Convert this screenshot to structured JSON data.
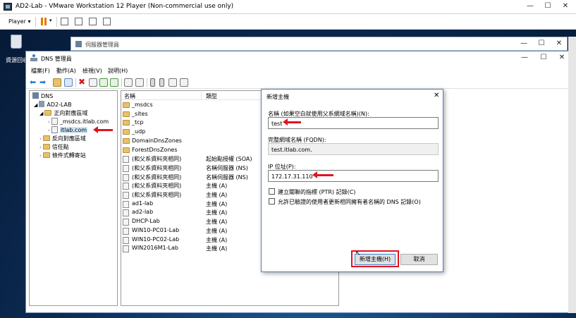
{
  "vmware": {
    "title": "AD2-Lab - VMware Workstation 12 Player (Non-commercial use only)",
    "player_menu": "Player ▾"
  },
  "desktop": {
    "recycle_bin_label": "資源回收"
  },
  "server_manager": {
    "title": "伺服器管理員"
  },
  "dns_manager": {
    "title": "DNS 管理員",
    "menu": [
      "檔案(F)",
      "動作(A)",
      "檢視(V)",
      "說明(H)"
    ],
    "tree": [
      {
        "label": "DNS",
        "level": 0
      },
      {
        "label": "AD2-LAB",
        "level": 1
      },
      {
        "label": "正向對應區域",
        "level": 2
      },
      {
        "label": "_msdcs.itlab.com",
        "level": 3
      },
      {
        "label": "itlab.com",
        "level": 3
      },
      {
        "label": "反向對應區域",
        "level": 2
      },
      {
        "label": "信任點",
        "level": 2
      },
      {
        "label": "條件式轉寄站",
        "level": 2
      }
    ],
    "list_headers": {
      "name": "名稱",
      "type": "類型"
    },
    "list_rows": [
      {
        "name": "_msdcs",
        "type": "",
        "icon": "folder"
      },
      {
        "name": "_sites",
        "type": "",
        "icon": "folder"
      },
      {
        "name": "_tcp",
        "type": "",
        "icon": "folder"
      },
      {
        "name": "_udp",
        "type": "",
        "icon": "folder"
      },
      {
        "name": "DomainDnsZones",
        "type": "",
        "icon": "folder"
      },
      {
        "name": "ForestDnsZones",
        "type": "",
        "icon": "folder"
      },
      {
        "name": "(和父系資料夾相同)",
        "type": "起始點授權 (SOA)",
        "icon": "doc"
      },
      {
        "name": "(和父系資料夾相同)",
        "type": "名稱伺服器 (NS)",
        "icon": "doc"
      },
      {
        "name": "(和父系資料夾相同)",
        "type": "名稱伺服器 (NS)",
        "icon": "doc"
      },
      {
        "name": "(和父系資料夾相同)",
        "type": "主機 (A)",
        "icon": "doc"
      },
      {
        "name": "(和父系資料夾相同)",
        "type": "主機 (A)",
        "icon": "doc"
      },
      {
        "name": "ad1-lab",
        "type": "主機 (A)",
        "icon": "doc"
      },
      {
        "name": "ad2-lab",
        "type": "主機 (A)",
        "icon": "doc"
      },
      {
        "name": "DHCP-Lab",
        "type": "主機 (A)",
        "icon": "doc"
      },
      {
        "name": "WIN10-PC01-Lab",
        "type": "主機 (A)",
        "icon": "doc"
      },
      {
        "name": "WIN10-PC02-Lab",
        "type": "主機 (A)",
        "icon": "doc"
      },
      {
        "name": "WIN2016M1-Lab",
        "type": "主機 (A)",
        "icon": "doc"
      }
    ]
  },
  "dialog": {
    "title": "新增主機",
    "name_label": "名稱 (如果空白就使用父系網域名稱)(N):",
    "name_value": "test",
    "fqdn_label": "完整網域名稱 (FQDN):",
    "fqdn_value": "test.itlab.com.",
    "ip_label": "IP 位址(P):",
    "ip_value": "172.17.31.110",
    "ptr_checkbox": "建立關聯的指標 (PTR) 記錄(C)",
    "update_checkbox": "允許已驗證的使用者更新相同擁有者名稱的 DNS 記錄(O)",
    "add_button": "新增主機(H)",
    "cancel_button": "取消",
    "close_glyph": "✕"
  },
  "colors": {
    "highlight": "#e0141e",
    "desktop": "#0b2a52"
  }
}
